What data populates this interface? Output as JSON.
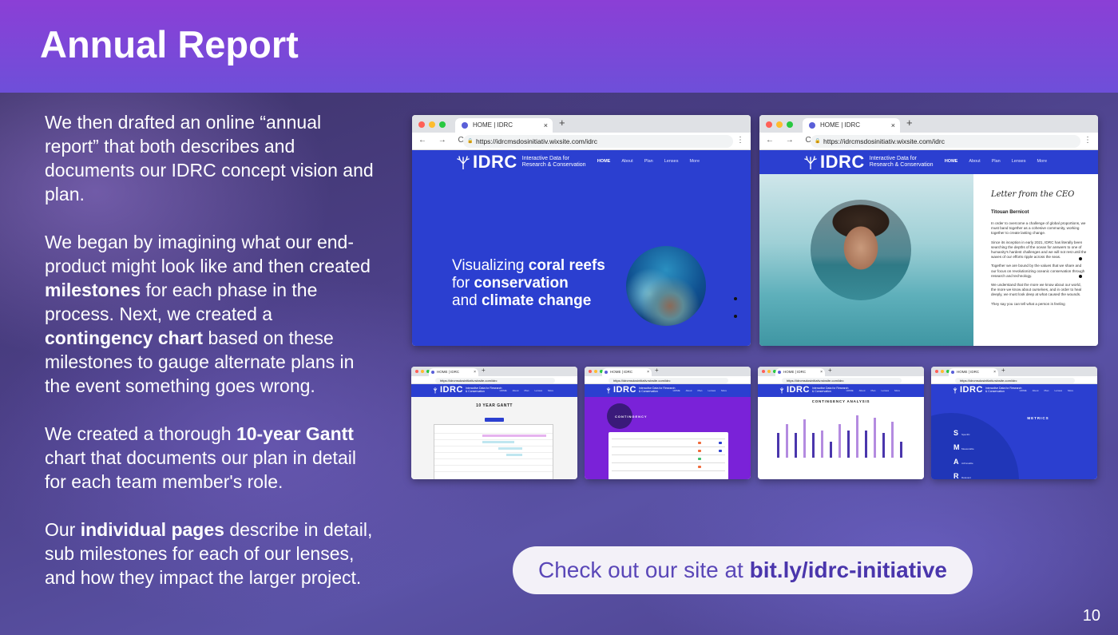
{
  "slide": {
    "title": "Annual Report",
    "page_number": "10"
  },
  "body": {
    "p1": "We then drafted an online “annual report” that both describes and documents our IDRC concept vision and plan.",
    "p2_a": "We began by imagining what our end-product might look like and then created ",
    "p2_b1": "milestones",
    "p2_c": " for each phase in the process. Next, we created a ",
    "p2_b2": "contingency chart",
    "p2_d": " based on these milestones to gauge alternate plans in the event something goes wrong.",
    "p3_a": "We created a thorough ",
    "p3_b": "10-year Gantt",
    "p3_c": " chart that documents our plan in detail for each team member's role.",
    "p4_a": "Our ",
    "p4_b": "individual pages",
    "p4_c": " describe in detail, sub milestones for each of our lenses, and how they impact the larger project."
  },
  "cta": {
    "prefix": "Check out our site at ",
    "link": "bit.ly/idrc-initiative"
  },
  "browser": {
    "tab_title": "HOME | IDRC",
    "tab_close": "×",
    "tab_new": "+",
    "nav_controls": "← → C",
    "menu": "⋮",
    "url": "https://idrcmsdosinitiativ.wixsite.com/idrc",
    "url_short": "https://idrcmsdosinitiativ.wixsite.com/idrc"
  },
  "site": {
    "logo": "IDRC",
    "logo_sub": "Interactive Data for Research & Conservation",
    "nav": [
      "HOME",
      "About",
      "Plan",
      "Lenses",
      "More"
    ],
    "hero_line1_a": "Visualizing ",
    "hero_line1_b": "coral reefs",
    "hero_line2_a": "for ",
    "hero_line2_b": "conservation",
    "hero_line3_a": "and ",
    "hero_line3_b": "climate change",
    "ceo_title": "Letter from the CEO",
    "ceo_name": "Titouan Bernicot",
    "ceo_p1": "In order to overcome a challenge of global proportions, we must band together as a cohesive community, working together to create lasting change.",
    "ceo_p2": "Since its inception in early 2021, IDRC has literally been searching the depths of the ocean for answers to one of humanity's hardest challenges and we will not rest until the waves of our efforts ripple across the seas.",
    "ceo_p3": "Together we are bound by the values that we share and our focus on revolutionizing oceanic conservation through research and technology.",
    "ceo_p4": "We understand that the more we know about our world, the more we know about ourselves, and in order to heal deeply, we must look deep at what caused the wounds.",
    "ceo_p5": "They say you can tell what a person is feeling",
    "gantt_title": "10 YEAR GANTT",
    "contingency_title": "CONTINGENCY",
    "analysis_title": "CONTINGENCY ANALYSIS",
    "metrics_title": "METRICS",
    "smart_letters": [
      "S",
      "M",
      "A",
      "R"
    ],
    "smart_words": [
      "Specific",
      "Measurable",
      "Achievable",
      "Relevant"
    ]
  },
  "colors": {
    "header_top": "#8b3fd6",
    "header_bottom": "#6e4fd9",
    "site_blue": "#2b3fd0",
    "cta_text": "#5a47b8"
  }
}
